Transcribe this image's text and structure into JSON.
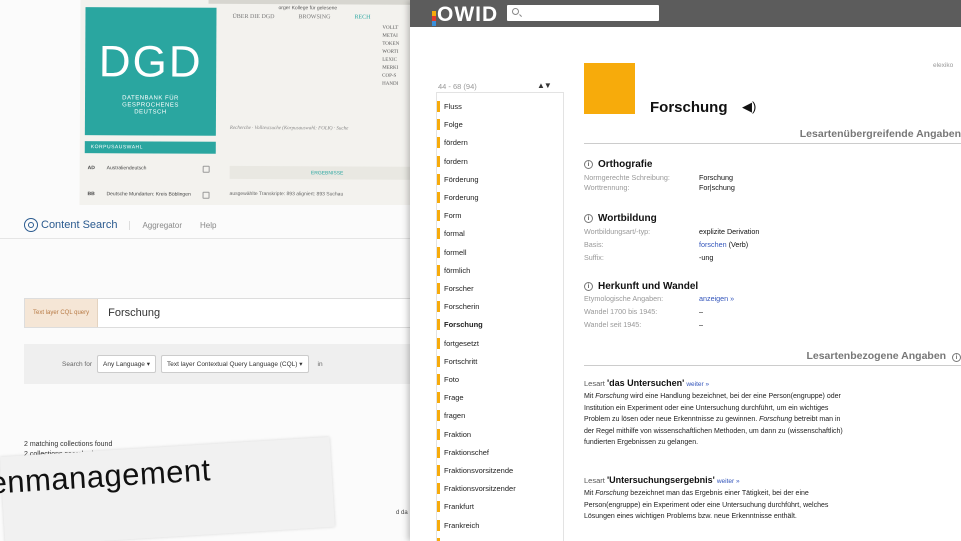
{
  "dgd": {
    "logo_text": "DGD",
    "logo_subtitle_1": "DATENBANK FÜR",
    "logo_subtitle_2": "GESPROCHENES",
    "logo_subtitle_3": "DEUTSCH",
    "topbar_text": "orger Kollege für gelesene",
    "nav": [
      "ÜBER DIE DGD",
      "BROWSING",
      "RECH"
    ],
    "right_column": [
      "VOLLT",
      "METAI",
      "TOKEN",
      "WORTI",
      "LEXIC",
      "MERKI",
      "COP-S",
      "HANDI"
    ],
    "breadcrumb": "Recherche · Volltextsuche (Korpusauswahl: FOLK) · Suche",
    "corpus_header": "KORPUSAUSWAHL",
    "corpora": [
      {
        "code": "AD",
        "name": "Australiendeutsch"
      },
      {
        "code": "BB",
        "name": "Deutsche Mundarten: Kreis Böblingen"
      }
    ],
    "results_label": "ERGEBNISSE",
    "stats": "ausgewählte Transkripte: 893   aligniert: 893   Suchau"
  },
  "content_search": {
    "brand": "Content Search",
    "tabs": [
      "Aggregator",
      "Help"
    ],
    "query_label": "Text layer CQL query",
    "query_value": "Forschung",
    "search_for_label": "Search for",
    "language_select": "Any Language ▾",
    "layer_select": "Text layer Contextual Query Language (CQL) ▾",
    "in_label": "in",
    "found_line_1": "2 matching collections found",
    "found_line_2": "2 collections searched",
    "banner_text": "enmanagement",
    "right_fragment": "d da"
  },
  "owid": {
    "logo_text": "OWID",
    "logo_bar_colors": [
      "#f7ab0b",
      "#e0392b",
      "#3a8fd9"
    ],
    "search_placeholder": "",
    "range": "44 - 68 (94)",
    "sort_arrows": "▲▼",
    "list": [
      "Fluss",
      "Folge",
      "fördern",
      "fordern",
      "Förderung",
      "Forderung",
      "Form",
      "formal",
      "formell",
      "förmlich",
      "Forscher",
      "Forscherin",
      "Forschung",
      "fortgesetzt",
      "Fortschritt",
      "Foto",
      "Frage",
      "fragen",
      "Fraktion",
      "Fraktionschef",
      "Fraktionsvorsitzende",
      "Fraktionsvorsitzender",
      "Frankfurt",
      "Frankreich",
      "Franz"
    ],
    "active_item": "Forschung",
    "accent_color": "#f7ab0b",
    "elexiko": "elexiko",
    "headword": "Forschung",
    "speaker_icon": "speaker-icon",
    "section_general": "Lesartenübergreifende Angaben",
    "orthografie": {
      "title": "Orthografie",
      "rows": [
        {
          "key": "Normgerechte Schreibung:",
          "value": "Forschung"
        },
        {
          "key": "Worttrennung:",
          "value": "For|schung"
        }
      ]
    },
    "wortbildung": {
      "title": "Wortbildung",
      "rows": [
        {
          "key": "Wortbildungsart/-typ:",
          "value": "explizite Derivation"
        },
        {
          "key": "Basis:",
          "value": "forschen",
          "suffix": " (Verb)"
        },
        {
          "key": "Suffix:",
          "value": "-ung"
        }
      ]
    },
    "herkunft": {
      "title": "Herkunft und Wandel",
      "rows": [
        {
          "key": "Etymologische Angaben:",
          "value": "anzeigen »"
        },
        {
          "key": "Wandel 1700 bis 1945:",
          "value": "–"
        },
        {
          "key": "Wandel seit 1945:",
          "value": "–"
        }
      ]
    },
    "section_specific": "Lesartenbezogene Angaben",
    "lesart1": {
      "prefix": "Lesart",
      "title": "'das Untersuchen'",
      "more": "weiter »",
      "text_before": "Mit ",
      "text_italic": "Forschung",
      "text_1": " wird eine Handlung bezeichnet, bei der eine Person(engruppe) oder",
      "text_2": "Institution ein Experiment oder eine Untersuchung durchführt, um ein wichtiges",
      "text_3a": "Problem zu lösen oder neue Erkenntnisse zu gewinnen. ",
      "text_3_italic": "Forschung",
      "text_3b": " betreibt man in",
      "text_4": "der Regel mithilfe von wissenschaftlichen Methoden, um dann zu (wissenschaftlich)",
      "text_5": "fundierten Ergebnissen zu gelangen."
    },
    "lesart2": {
      "prefix": "Lesart",
      "title": "'Untersuchungsergebnis'",
      "more": "weiter »",
      "text_before": "Mit ",
      "text_italic": "Forschung",
      "text_1": " bezeichnet man das Ergebnis einer Tätigkeit, bei der eine",
      "text_2": "Person(engruppe) ein Experiment oder eine Untersuchung durchführt, welches",
      "text_3": "Lösungen eines wichtigen Problems bzw. neue Erkenntnisse enthält."
    }
  }
}
